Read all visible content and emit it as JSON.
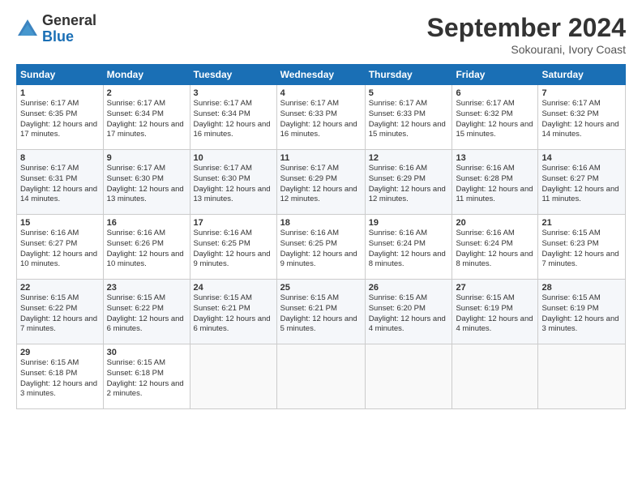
{
  "logo": {
    "general": "General",
    "blue": "Blue"
  },
  "header": {
    "month": "September 2024",
    "location": "Sokourani, Ivory Coast"
  },
  "weekdays": [
    "Sunday",
    "Monday",
    "Tuesday",
    "Wednesday",
    "Thursday",
    "Friday",
    "Saturday"
  ],
  "weeks": [
    [
      {
        "day": "1",
        "sunrise": "6:17 AM",
        "sunset": "6:35 PM",
        "daylight": "12 hours and 17 minutes."
      },
      {
        "day": "2",
        "sunrise": "6:17 AM",
        "sunset": "6:34 PM",
        "daylight": "12 hours and 17 minutes."
      },
      {
        "day": "3",
        "sunrise": "6:17 AM",
        "sunset": "6:34 PM",
        "daylight": "12 hours and 16 minutes."
      },
      {
        "day": "4",
        "sunrise": "6:17 AM",
        "sunset": "6:33 PM",
        "daylight": "12 hours and 16 minutes."
      },
      {
        "day": "5",
        "sunrise": "6:17 AM",
        "sunset": "6:33 PM",
        "daylight": "12 hours and 15 minutes."
      },
      {
        "day": "6",
        "sunrise": "6:17 AM",
        "sunset": "6:32 PM",
        "daylight": "12 hours and 15 minutes."
      },
      {
        "day": "7",
        "sunrise": "6:17 AM",
        "sunset": "6:32 PM",
        "daylight": "12 hours and 14 minutes."
      }
    ],
    [
      {
        "day": "8",
        "sunrise": "6:17 AM",
        "sunset": "6:31 PM",
        "daylight": "12 hours and 14 minutes."
      },
      {
        "day": "9",
        "sunrise": "6:17 AM",
        "sunset": "6:30 PM",
        "daylight": "12 hours and 13 minutes."
      },
      {
        "day": "10",
        "sunrise": "6:17 AM",
        "sunset": "6:30 PM",
        "daylight": "12 hours and 13 minutes."
      },
      {
        "day": "11",
        "sunrise": "6:17 AM",
        "sunset": "6:29 PM",
        "daylight": "12 hours and 12 minutes."
      },
      {
        "day": "12",
        "sunrise": "6:16 AM",
        "sunset": "6:29 PM",
        "daylight": "12 hours and 12 minutes."
      },
      {
        "day": "13",
        "sunrise": "6:16 AM",
        "sunset": "6:28 PM",
        "daylight": "12 hours and 11 minutes."
      },
      {
        "day": "14",
        "sunrise": "6:16 AM",
        "sunset": "6:27 PM",
        "daylight": "12 hours and 11 minutes."
      }
    ],
    [
      {
        "day": "15",
        "sunrise": "6:16 AM",
        "sunset": "6:27 PM",
        "daylight": "12 hours and 10 minutes."
      },
      {
        "day": "16",
        "sunrise": "6:16 AM",
        "sunset": "6:26 PM",
        "daylight": "12 hours and 10 minutes."
      },
      {
        "day": "17",
        "sunrise": "6:16 AM",
        "sunset": "6:25 PM",
        "daylight": "12 hours and 9 minutes."
      },
      {
        "day": "18",
        "sunrise": "6:16 AM",
        "sunset": "6:25 PM",
        "daylight": "12 hours and 9 minutes."
      },
      {
        "day": "19",
        "sunrise": "6:16 AM",
        "sunset": "6:24 PM",
        "daylight": "12 hours and 8 minutes."
      },
      {
        "day": "20",
        "sunrise": "6:16 AM",
        "sunset": "6:24 PM",
        "daylight": "12 hours and 8 minutes."
      },
      {
        "day": "21",
        "sunrise": "6:15 AM",
        "sunset": "6:23 PM",
        "daylight": "12 hours and 7 minutes."
      }
    ],
    [
      {
        "day": "22",
        "sunrise": "6:15 AM",
        "sunset": "6:22 PM",
        "daylight": "12 hours and 7 minutes."
      },
      {
        "day": "23",
        "sunrise": "6:15 AM",
        "sunset": "6:22 PM",
        "daylight": "12 hours and 6 minutes."
      },
      {
        "day": "24",
        "sunrise": "6:15 AM",
        "sunset": "6:21 PM",
        "daylight": "12 hours and 6 minutes."
      },
      {
        "day": "25",
        "sunrise": "6:15 AM",
        "sunset": "6:21 PM",
        "daylight": "12 hours and 5 minutes."
      },
      {
        "day": "26",
        "sunrise": "6:15 AM",
        "sunset": "6:20 PM",
        "daylight": "12 hours and 4 minutes."
      },
      {
        "day": "27",
        "sunrise": "6:15 AM",
        "sunset": "6:19 PM",
        "daylight": "12 hours and 4 minutes."
      },
      {
        "day": "28",
        "sunrise": "6:15 AM",
        "sunset": "6:19 PM",
        "daylight": "12 hours and 3 minutes."
      }
    ],
    [
      {
        "day": "29",
        "sunrise": "6:15 AM",
        "sunset": "6:18 PM",
        "daylight": "12 hours and 3 minutes."
      },
      {
        "day": "30",
        "sunrise": "6:15 AM",
        "sunset": "6:18 PM",
        "daylight": "12 hours and 2 minutes."
      },
      null,
      null,
      null,
      null,
      null
    ]
  ],
  "labels": {
    "sunrise": "Sunrise:",
    "sunset": "Sunset:",
    "daylight": "Daylight:"
  }
}
